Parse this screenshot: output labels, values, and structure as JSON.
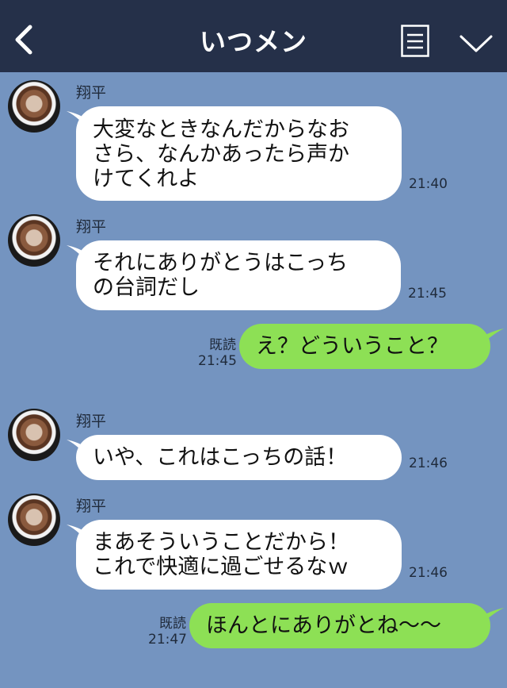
{
  "header": {
    "title": "いつメン"
  },
  "colors": {
    "header_bg": "#253049",
    "chat_bg": "#7494c0",
    "incoming_bubble": "#ffffff",
    "outgoing_bubble": "#8de055"
  },
  "icons": {
    "back": "chevron-left-icon",
    "menu": "notes-icon",
    "more": "chevron-down-icon"
  },
  "messages": [
    {
      "direction": "in",
      "sender": "翔平",
      "lines": [
        "大変なときなんだからなお",
        "さら、なんかあったら声か",
        "けてくれよ"
      ],
      "time": "21:40"
    },
    {
      "direction": "in",
      "sender": "翔平",
      "lines": [
        "それにありがとうはこっち",
        "の台詞だし"
      ],
      "time": "21:45"
    },
    {
      "direction": "out",
      "lines": [
        "え？どういうこと？"
      ],
      "read": "既読",
      "time": "21:45"
    },
    {
      "direction": "in",
      "sender": "翔平",
      "lines": [
        "いや、これはこっちの話！"
      ],
      "time": "21:46"
    },
    {
      "direction": "in",
      "sender": "翔平",
      "lines": [
        "まあそういうことだから！",
        "これで快適に過ごせるなｗ"
      ],
      "time": "21:46"
    },
    {
      "direction": "out",
      "lines": [
        "ほんとにありがとね〜〜"
      ],
      "read": "既読",
      "time": "21:47"
    }
  ]
}
